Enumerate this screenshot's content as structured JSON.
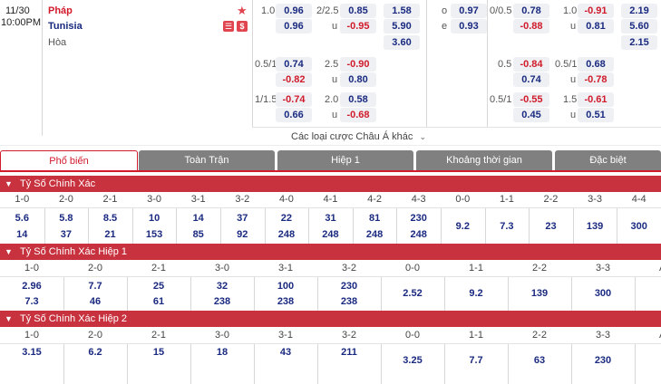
{
  "match": {
    "date": "11/30",
    "time": "10:00PM",
    "home": "Pháp",
    "away": "Tunisia",
    "draw": "Hòa",
    "colors": {
      "accent": "#d11a2a",
      "navy": "#1a2a80",
      "tab_gray": "#808080",
      "section": "#c8323f"
    }
  },
  "odds_block_left": {
    "row1": {
      "line": "1.0",
      "v1": "0.96",
      "ou": "2/2.5",
      "v2": "0.85",
      "x": "1.58"
    },
    "row2": {
      "v1": "0.96",
      "u": "u",
      "v2": "-0.95",
      "x": "5.90"
    },
    "row3": {
      "x": "3.60"
    },
    "row4": {
      "line": "0.5/1",
      "v1": "0.74",
      "ou": "2.5",
      "v2": "-0.90"
    },
    "row5": {
      "v1": "-0.82",
      "u": "u",
      "v2": "0.80"
    },
    "row6": {
      "line": "1/1.5",
      "v1": "-0.74",
      "ou": "2.0",
      "v2": "0.58"
    },
    "row7": {
      "v1": "0.66",
      "u": "u",
      "v2": "-0.68"
    }
  },
  "odds_block_mid": {
    "o_label": "o",
    "o_val": "0.97",
    "e_label": "e",
    "e_val": "0.93"
  },
  "odds_block_right": {
    "row1": {
      "line": "0/0.5",
      "v1": "0.78",
      "ou": "1.0",
      "v2": "-0.91",
      "x": "2.19"
    },
    "row2": {
      "v1": "-0.88",
      "u": "u",
      "v2": "0.81",
      "x": "5.60"
    },
    "row3": {
      "x": "2.15"
    },
    "row4": {
      "line": "0.5",
      "v1": "-0.84",
      "ou": "0.5/1",
      "v2": "0.68"
    },
    "row5": {
      "v1": "0.74",
      "u": "u",
      "v2": "-0.78"
    },
    "row6": {
      "line": "0.5/1",
      "v1": "-0.55",
      "ou": "1.5",
      "v2": "-0.61"
    },
    "row7": {
      "v1": "0.45",
      "u": "u",
      "v2": "0.51"
    }
  },
  "more_link": "Các loại cược Châu Á khác",
  "tabs": [
    "Phổ biến",
    "Toàn Trận",
    "Hiệp 1",
    "Khoảng thời gian",
    "Đặc biệt"
  ],
  "section1": {
    "title": "Tỷ Số Chính Xác",
    "headers": [
      "1-0",
      "2-0",
      "2-1",
      "3-0",
      "3-1",
      "3-2",
      "4-0",
      "4-1",
      "4-2",
      "4-3",
      "0-0",
      "1-1",
      "2-2",
      "3-3",
      "4-4"
    ],
    "top": [
      "5.6",
      "5.8",
      "8.5",
      "10",
      "14",
      "37",
      "22",
      "31",
      "81",
      "230",
      "",
      "",
      "",
      "",
      ""
    ],
    "bottom": [
      "14",
      "37",
      "21",
      "153",
      "85",
      "92",
      "248",
      "248",
      "248",
      "248",
      "",
      "",
      "",
      "",
      ""
    ],
    "mid": [
      "",
      "",
      "",
      "",
      "",
      "",
      "",
      "",
      "",
      "",
      "9.2",
      "7.3",
      "23",
      "139",
      "300"
    ]
  },
  "section2": {
    "title": "Tỷ Số Chính Xác Hiệp 1",
    "headers": [
      "1-0",
      "2-0",
      "2-1",
      "3-0",
      "3-1",
      "3-2",
      "0-0",
      "1-1",
      "2-2",
      "3-3",
      "AO"
    ],
    "top": [
      "2.96",
      "7.7",
      "25",
      "32",
      "100",
      "230",
      "",
      "",
      "",
      "",
      ""
    ],
    "bottom": [
      "7.3",
      "46",
      "61",
      "238",
      "238",
      "238",
      "",
      "",
      "",
      "",
      ""
    ],
    "mid": [
      "",
      "",
      "",
      "",
      "",
      "",
      "2.52",
      "9.2",
      "139",
      "300",
      ""
    ]
  },
  "section3": {
    "title": "Tỷ Số Chính Xác Hiệp 2",
    "headers": [
      "1-0",
      "2-0",
      "2-1",
      "3-0",
      "3-1",
      "3-2",
      "0-0",
      "1-1",
      "2-2",
      "3-3",
      "AO"
    ],
    "top": [
      "3.15",
      "6.2",
      "15",
      "18",
      "43",
      "211",
      "",
      "",
      "",
      "",
      ""
    ],
    "mid": [
      "",
      "",
      "",
      "",
      "",
      "",
      "3.25",
      "7.7",
      "63",
      "230",
      ""
    ]
  }
}
